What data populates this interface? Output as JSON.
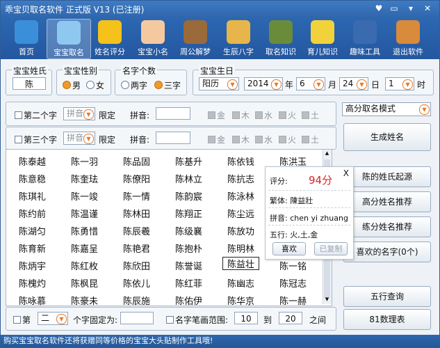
{
  "window": {
    "title": "乖宝贝取名软件  正式版 V13  (已注册)"
  },
  "toolbar": [
    {
      "label": "首页",
      "icon": "monitor-icon"
    },
    {
      "label": "宝宝取名",
      "icon": "pen-board-icon",
      "active": true
    },
    {
      "label": "姓名评分",
      "icon": "star-icon"
    },
    {
      "label": "宝宝小名",
      "icon": "baby-icon"
    },
    {
      "label": "周公解梦",
      "icon": "sage-icon"
    },
    {
      "label": "生辰八字",
      "icon": "bagua-icon"
    },
    {
      "label": "取名知识",
      "icon": "books-icon"
    },
    {
      "label": "育儿知识",
      "icon": "sunflower-icon"
    },
    {
      "label": "趣味工具",
      "icon": "atv-icon"
    },
    {
      "label": "退出软件",
      "icon": "exit-door-icon"
    }
  ],
  "surname": {
    "title": "宝宝姓氏",
    "value": "陈"
  },
  "gender": {
    "title": "宝宝性别",
    "options": [
      "男",
      "女"
    ],
    "selected": "男"
  },
  "name_length": {
    "title": "名字个数",
    "options": [
      "两字",
      "三字"
    ],
    "selected": "三字"
  },
  "birth": {
    "title": "宝宝生日",
    "calendar": "阳历",
    "year": "2014",
    "year_unit": "年",
    "month": "6",
    "month_unit": "月",
    "day": "24",
    "day_unit": "日",
    "hour": "1",
    "hour_unit": "时"
  },
  "char2": {
    "label": "第二个字",
    "mode": "拼音",
    "fixed_label": "限定",
    "pinyin_label": "拼音:",
    "pinyin_value": "",
    "elements": [
      "金",
      "木",
      "水",
      "火",
      "土"
    ]
  },
  "char3": {
    "label": "第三个字",
    "mode": "拼音",
    "fixed_label": "限定",
    "pinyin_label": "拼音:",
    "pinyin_value": "",
    "elements": [
      "金",
      "木",
      "水",
      "火",
      "土"
    ]
  },
  "mode_select": "高分取名模式",
  "buttons": {
    "generate": "生成姓名",
    "origin": "陈的姓氏起源",
    "high_score": "高分姓名推荐",
    "twin": "练分姓名推荐",
    "favorites": "喜欢的名字(0个)",
    "wuxing": "五行查询",
    "numerology": "81数理表"
  },
  "names": [
    [
      "陈泰越",
      "陈一羽",
      "陈品固",
      "陈基升",
      "陈依钱",
      "陈洪玉"
    ],
    [
      "陈意稳",
      "陈奎珐",
      "陈僚阳",
      "陈林立",
      "陈抗志",
      "陈"
    ],
    [
      "陈琪礼",
      "陈一竣",
      "陈一情",
      "陈韵宸",
      "陈泳林",
      "陈"
    ],
    [
      "陈约前",
      "陈温谨",
      "陈林田",
      "陈翔正",
      "陈尘远",
      "陈"
    ],
    [
      "陈湖匀",
      "陈勇惜",
      "陈辰羲",
      "陈级襄",
      "陈放功",
      "陈"
    ],
    [
      "陈育新",
      "陈嘉呈",
      "陈艳君",
      "陈抱朴",
      "陈明林",
      "陈"
    ],
    [
      "陈炳宇",
      "陈红枚",
      "陈欣田",
      "陈誉诞",
      "陈益壮",
      "陈一铭"
    ],
    [
      "陈槐灼",
      "陈枫昆",
      "陈依儿",
      "陈红菲",
      "陈幽志",
      "陈冠志"
    ],
    [
      "陈咏慕",
      "陈豪未",
      "陈辰施",
      "陈佑伊",
      "陈华京",
      "陈一赫"
    ]
  ],
  "popup": {
    "close": "X",
    "score_label": "评分:",
    "score": "94分",
    "traditional": "繁体: 陳益壯",
    "pinyin": "拼音: chen yi zhuang",
    "wuxing": "五行: 火,土,金",
    "like": "喜欢",
    "copied": "已复制"
  },
  "bottom": {
    "pos_label": "第",
    "pos_value": "二",
    "fixed_label": "个字固定为:",
    "fixed_value": "",
    "stroke_label": "名字笔画范围:",
    "stroke_from": "10",
    "to": "到",
    "stroke_to": "20",
    "between": "之间"
  },
  "status": "购买宝宝取名软件还将获赠同等价格的宝宝大头贴制作工具哦!"
}
